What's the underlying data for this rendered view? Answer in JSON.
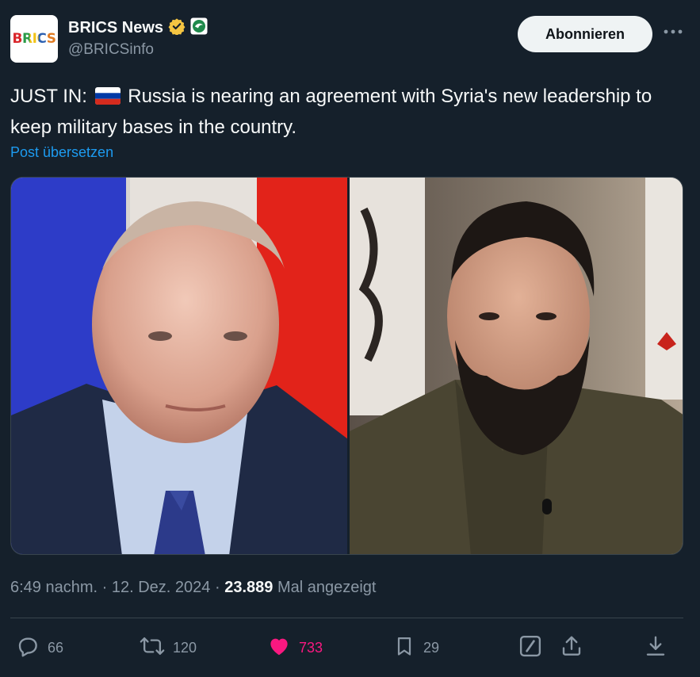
{
  "account": {
    "avatar_text": "BRICS",
    "display_name": "BRICS News",
    "handle": "@BRICSinfo",
    "verified_badge_color": "#f4c542",
    "affiliate_badge_color": "#3ec47e"
  },
  "follow_button": {
    "label": "Abonnieren"
  },
  "tweet": {
    "text_prefix": "JUST IN:",
    "flag": "russia-flag-icon",
    "text_body": "Russia is nearing an agreement with Syria's new leadership to keep military bases in the country.",
    "translate_link": "Post übersetzen"
  },
  "media": {
    "left_image": "photo-man-in-suit-with-russian-flag-background",
    "right_image": "photo-bearded-man-in-olive-shirt"
  },
  "meta": {
    "time": "6:49 nachm.",
    "separator": "·",
    "date": "12. Dez. 2024",
    "views": "23.889",
    "views_label": "Mal angezeigt"
  },
  "actions": {
    "replies": "66",
    "reposts": "120",
    "likes": "733",
    "bookmarks": "29"
  },
  "colors": {
    "background": "#15202b",
    "link": "#1d9bf0",
    "like": "#f91880",
    "muted": "#8b98a5"
  }
}
